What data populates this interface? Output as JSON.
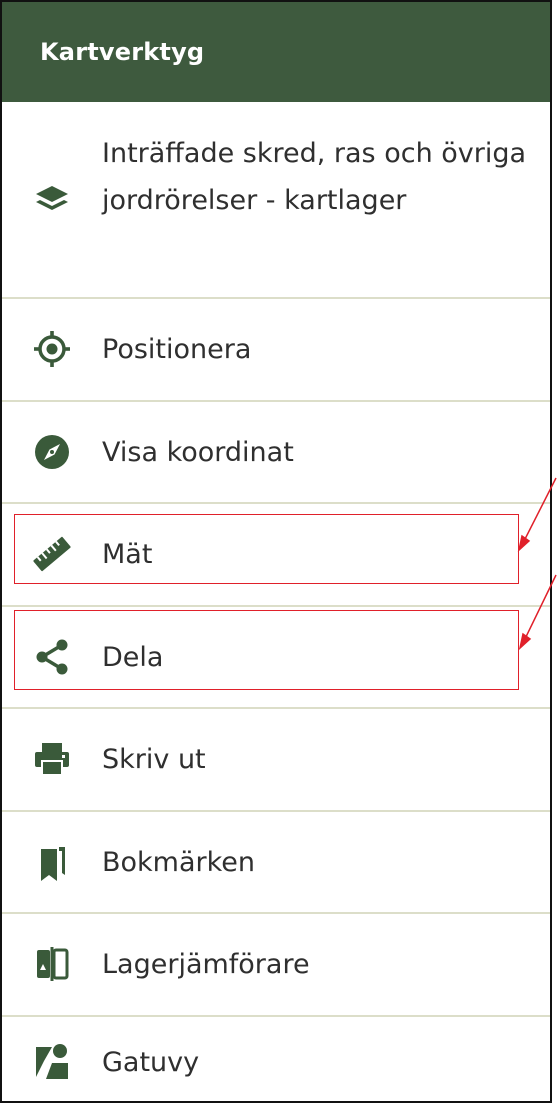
{
  "header": {
    "title": "Kartverktyg"
  },
  "items": [
    {
      "label": "Inträffade skred, ras och övriga jordrörelser - kartlager",
      "icon": "layers-icon"
    },
    {
      "label": "Positionera",
      "icon": "crosshair-icon"
    },
    {
      "label": "Visa koordinat",
      "icon": "compass-icon"
    },
    {
      "label": "Mät",
      "icon": "ruler-icon"
    },
    {
      "label": "Dela",
      "icon": "share-icon"
    },
    {
      "label": "Skriv ut",
      "icon": "printer-icon"
    },
    {
      "label": "Bokmärken",
      "icon": "bookmarks-icon"
    },
    {
      "label": "Lagerjämförare",
      "icon": "compare-icon"
    },
    {
      "label": "Gatuvy",
      "icon": "street-view-icon"
    }
  ],
  "colors": {
    "header_bg": "#3e5a3e",
    "icon": "#3a5a3a",
    "divider": "#dcdec9",
    "annotation": "#e0202a"
  }
}
